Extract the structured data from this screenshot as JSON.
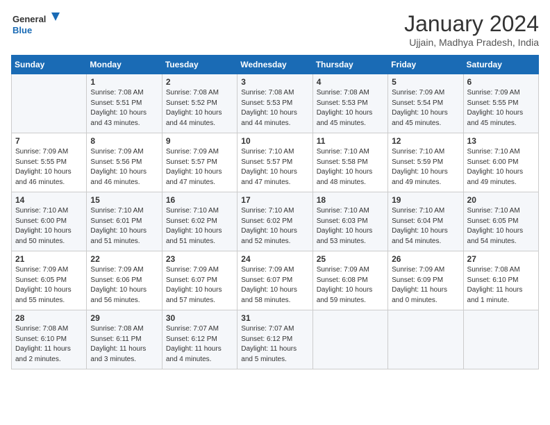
{
  "logo": {
    "line1": "General",
    "line2": "Blue"
  },
  "title": "January 2024",
  "location": "Ujjain, Madhya Pradesh, India",
  "weekdays": [
    "Sunday",
    "Monday",
    "Tuesday",
    "Wednesday",
    "Thursday",
    "Friday",
    "Saturday"
  ],
  "weeks": [
    [
      {
        "num": "",
        "info": ""
      },
      {
        "num": "1",
        "info": "Sunrise: 7:08 AM\nSunset: 5:51 PM\nDaylight: 10 hours\nand 43 minutes."
      },
      {
        "num": "2",
        "info": "Sunrise: 7:08 AM\nSunset: 5:52 PM\nDaylight: 10 hours\nand 44 minutes."
      },
      {
        "num": "3",
        "info": "Sunrise: 7:08 AM\nSunset: 5:53 PM\nDaylight: 10 hours\nand 44 minutes."
      },
      {
        "num": "4",
        "info": "Sunrise: 7:08 AM\nSunset: 5:53 PM\nDaylight: 10 hours\nand 45 minutes."
      },
      {
        "num": "5",
        "info": "Sunrise: 7:09 AM\nSunset: 5:54 PM\nDaylight: 10 hours\nand 45 minutes."
      },
      {
        "num": "6",
        "info": "Sunrise: 7:09 AM\nSunset: 5:55 PM\nDaylight: 10 hours\nand 45 minutes."
      }
    ],
    [
      {
        "num": "7",
        "info": "Sunrise: 7:09 AM\nSunset: 5:55 PM\nDaylight: 10 hours\nand 46 minutes."
      },
      {
        "num": "8",
        "info": "Sunrise: 7:09 AM\nSunset: 5:56 PM\nDaylight: 10 hours\nand 46 minutes."
      },
      {
        "num": "9",
        "info": "Sunrise: 7:09 AM\nSunset: 5:57 PM\nDaylight: 10 hours\nand 47 minutes."
      },
      {
        "num": "10",
        "info": "Sunrise: 7:10 AM\nSunset: 5:57 PM\nDaylight: 10 hours\nand 47 minutes."
      },
      {
        "num": "11",
        "info": "Sunrise: 7:10 AM\nSunset: 5:58 PM\nDaylight: 10 hours\nand 48 minutes."
      },
      {
        "num": "12",
        "info": "Sunrise: 7:10 AM\nSunset: 5:59 PM\nDaylight: 10 hours\nand 49 minutes."
      },
      {
        "num": "13",
        "info": "Sunrise: 7:10 AM\nSunset: 6:00 PM\nDaylight: 10 hours\nand 49 minutes."
      }
    ],
    [
      {
        "num": "14",
        "info": "Sunrise: 7:10 AM\nSunset: 6:00 PM\nDaylight: 10 hours\nand 50 minutes."
      },
      {
        "num": "15",
        "info": "Sunrise: 7:10 AM\nSunset: 6:01 PM\nDaylight: 10 hours\nand 51 minutes."
      },
      {
        "num": "16",
        "info": "Sunrise: 7:10 AM\nSunset: 6:02 PM\nDaylight: 10 hours\nand 51 minutes."
      },
      {
        "num": "17",
        "info": "Sunrise: 7:10 AM\nSunset: 6:02 PM\nDaylight: 10 hours\nand 52 minutes."
      },
      {
        "num": "18",
        "info": "Sunrise: 7:10 AM\nSunset: 6:03 PM\nDaylight: 10 hours\nand 53 minutes."
      },
      {
        "num": "19",
        "info": "Sunrise: 7:10 AM\nSunset: 6:04 PM\nDaylight: 10 hours\nand 54 minutes."
      },
      {
        "num": "20",
        "info": "Sunrise: 7:10 AM\nSunset: 6:05 PM\nDaylight: 10 hours\nand 54 minutes."
      }
    ],
    [
      {
        "num": "21",
        "info": "Sunrise: 7:09 AM\nSunset: 6:05 PM\nDaylight: 10 hours\nand 55 minutes."
      },
      {
        "num": "22",
        "info": "Sunrise: 7:09 AM\nSunset: 6:06 PM\nDaylight: 10 hours\nand 56 minutes."
      },
      {
        "num": "23",
        "info": "Sunrise: 7:09 AM\nSunset: 6:07 PM\nDaylight: 10 hours\nand 57 minutes."
      },
      {
        "num": "24",
        "info": "Sunrise: 7:09 AM\nSunset: 6:07 PM\nDaylight: 10 hours\nand 58 minutes."
      },
      {
        "num": "25",
        "info": "Sunrise: 7:09 AM\nSunset: 6:08 PM\nDaylight: 10 hours\nand 59 minutes."
      },
      {
        "num": "26",
        "info": "Sunrise: 7:09 AM\nSunset: 6:09 PM\nDaylight: 11 hours\nand 0 minutes."
      },
      {
        "num": "27",
        "info": "Sunrise: 7:08 AM\nSunset: 6:10 PM\nDaylight: 11 hours\nand 1 minute."
      }
    ],
    [
      {
        "num": "28",
        "info": "Sunrise: 7:08 AM\nSunset: 6:10 PM\nDaylight: 11 hours\nand 2 minutes."
      },
      {
        "num": "29",
        "info": "Sunrise: 7:08 AM\nSunset: 6:11 PM\nDaylight: 11 hours\nand 3 minutes."
      },
      {
        "num": "30",
        "info": "Sunrise: 7:07 AM\nSunset: 6:12 PM\nDaylight: 11 hours\nand 4 minutes."
      },
      {
        "num": "31",
        "info": "Sunrise: 7:07 AM\nSunset: 6:12 PM\nDaylight: 11 hours\nand 5 minutes."
      },
      {
        "num": "",
        "info": ""
      },
      {
        "num": "",
        "info": ""
      },
      {
        "num": "",
        "info": ""
      }
    ]
  ]
}
